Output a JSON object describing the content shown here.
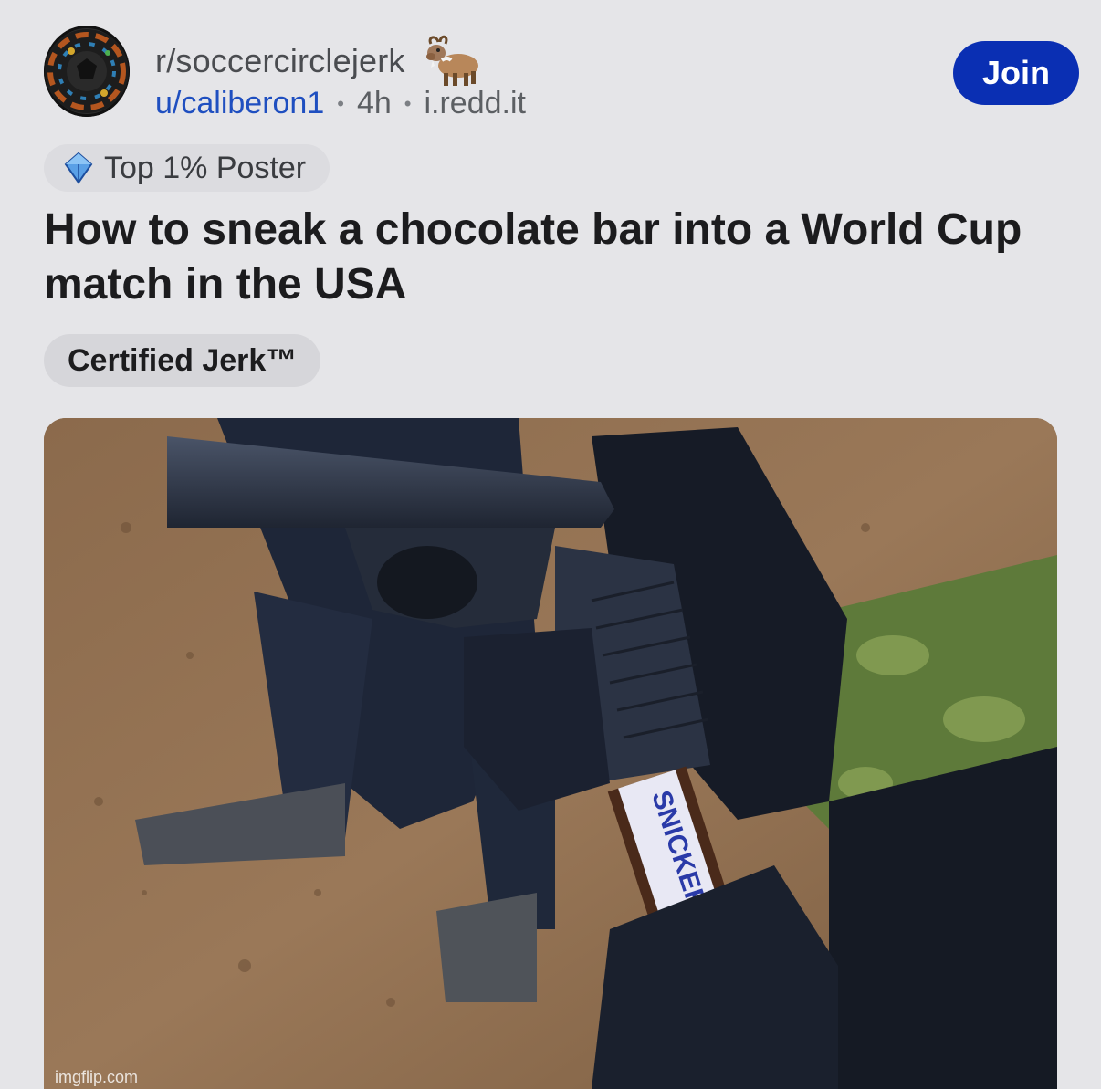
{
  "header": {
    "subreddit": "r/soccercirclejerk",
    "subreddit_icon": "goat-icon",
    "username": "u/caliberon1",
    "separator": "•",
    "age": "4h",
    "domain": "i.redd.it",
    "join_label": "Join"
  },
  "badge": {
    "icon": "diamond-icon",
    "label": "Top 1% Poster"
  },
  "post": {
    "title": "How to sneak a chocolate bar into a World Cup match in the USA",
    "flair": "Certified Jerk™"
  },
  "media": {
    "watermark": "imgflip.com",
    "candy_text": "SNICKERS"
  },
  "colors": {
    "join_bg": "#0a2fb3",
    "username": "#1f4fc0",
    "background": "#e5e5e8"
  }
}
